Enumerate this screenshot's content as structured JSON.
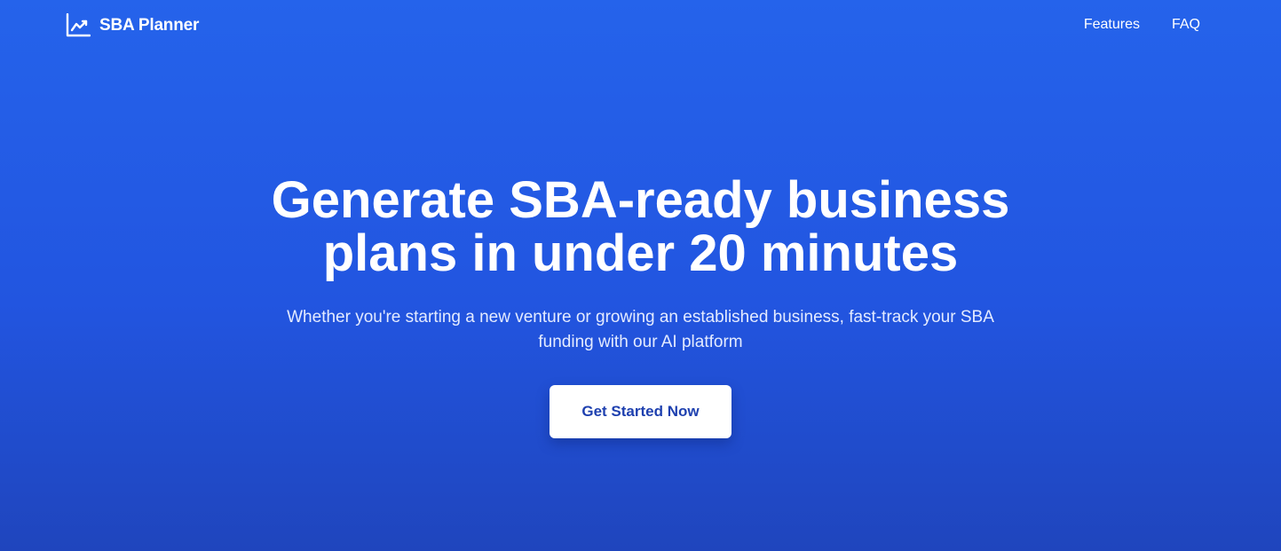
{
  "header": {
    "brand_name": "SBA Planner",
    "brand_icon": "trending-chart-icon",
    "nav": [
      {
        "label": "Features"
      },
      {
        "label": "FAQ"
      }
    ]
  },
  "hero": {
    "title_line1": "Generate SBA-ready business",
    "title_line2": "plans in under 20 minutes",
    "subtitle_line1": "Whether you're starting a new venture or growing an established business, fast-track your SBA",
    "subtitle_line2": "funding with our AI platform",
    "cta_label": "Get Started Now"
  },
  "colors": {
    "background": "#2563eb",
    "cta_text": "#1e40af",
    "cta_background": "#ffffff"
  }
}
